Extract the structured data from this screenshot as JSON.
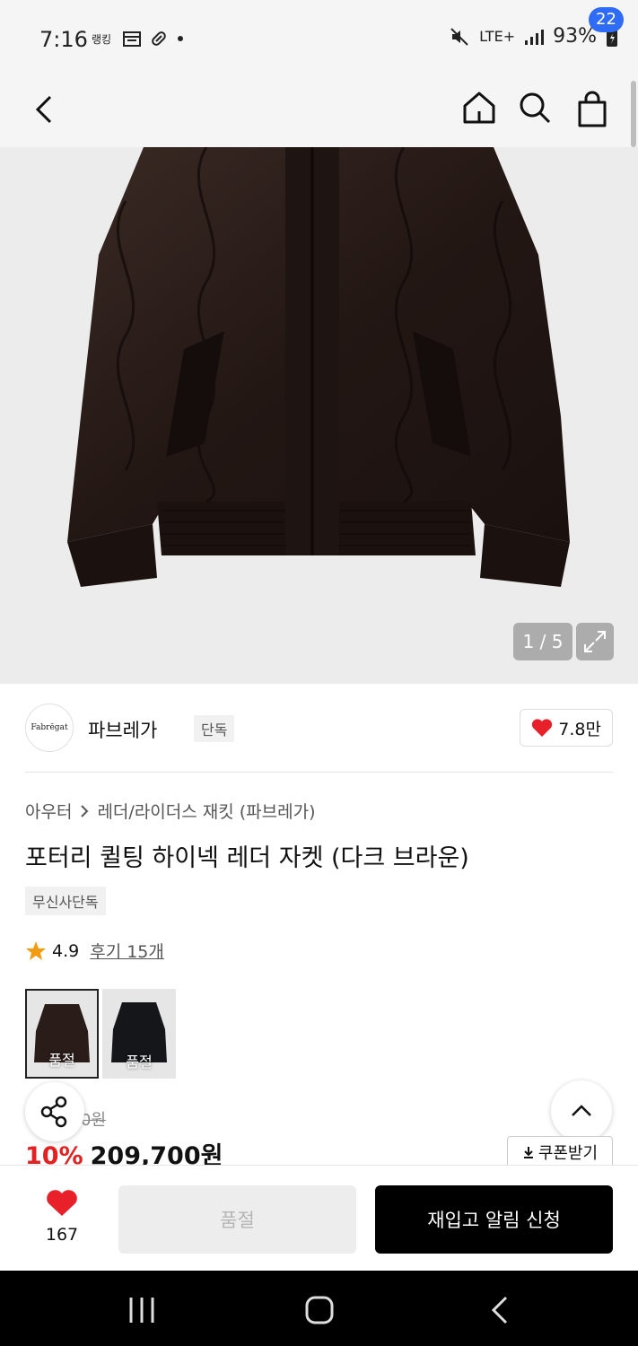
{
  "status_bar": {
    "time": "7:16",
    "network": "LTE+",
    "battery": "93%"
  },
  "header": {
    "cart_count": "22"
  },
  "gallery": {
    "counter": "1 / 5"
  },
  "brand": {
    "logo_text": "Fabrēgat",
    "name": "파브레가",
    "tag": "단독",
    "likes": "7.8만"
  },
  "product": {
    "breadcrumb": [
      "아우터",
      "레더/라이더스 재킷 (파브레가)"
    ],
    "title": "포터리 퀼팅 하이넥 레더 자켓 (다크 브라운)",
    "exclusive_tag": "무신사단독",
    "rating": "4.9",
    "reviews": "후기 15개",
    "variants": [
      {
        "label": "품절",
        "selected": true
      },
      {
        "label": "품절",
        "selected": false
      }
    ],
    "original_price_partial": "0원",
    "discount": "10%",
    "price": "209,700원",
    "coupon_label": "쿠폰받기"
  },
  "bottom_bar": {
    "wish_count": "167",
    "soldout_label": "품절",
    "restock_label": "재입고 알림 신청"
  },
  "colors": {
    "accent_blue": "#2f6cf6",
    "discount_red": "#e22222",
    "heart_red": "#e8202a"
  }
}
